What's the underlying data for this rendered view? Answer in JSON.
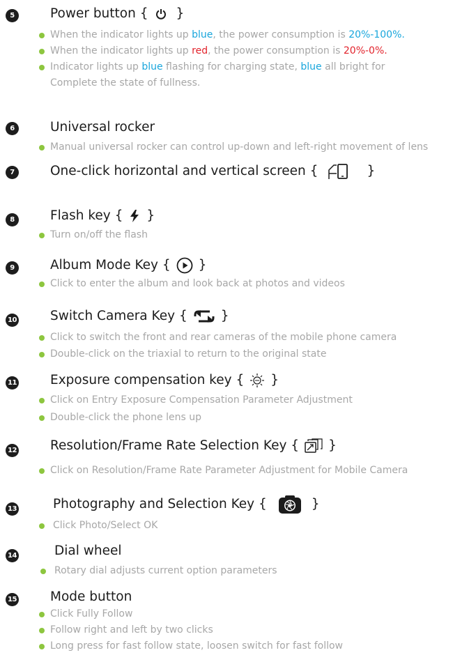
{
  "colors": {
    "bullet": "#8dc63f",
    "blue": "#19a6dc",
    "red": "#e2232c",
    "text": "#a7a7a7",
    "title": "#1c1c1c"
  },
  "sections": [
    {
      "number": "5",
      "title": "Power button",
      "icon": "power-icon",
      "brace_open": "{",
      "brace_close": "}",
      "bullets": [
        {
          "parts": [
            "When the indicator lights up ",
            "blue",
            ", the power consumption is ",
            "20%-100%."
          ]
        },
        {
          "parts": [
            "When the indicator lights up ",
            "red",
            ", the power consumption is ",
            "20%-0%."
          ]
        },
        {
          "parts": [
            "Indicator lights up ",
            "blue",
            " flashing for charging state, ",
            "blue",
            " all bright for"
          ]
        },
        {
          "text": "Complete the state of fullness."
        }
      ]
    },
    {
      "number": "6",
      "title": "Universal rocker",
      "bullets": [
        {
          "text": "Manual universal rocker can control up-down and left-right movement of lens"
        }
      ]
    },
    {
      "number": "7",
      "title": "One-click horizontal and vertical screen",
      "icon": "screen-rotate-icon",
      "brace_open": "{",
      "brace_close": "}",
      "bullets": []
    },
    {
      "number": "8",
      "title": "Flash key",
      "icon": "flash-icon",
      "brace_open": "{",
      "brace_close": "}",
      "bullets": [
        {
          "text": "Turn on/off the flash"
        }
      ]
    },
    {
      "number": "9",
      "title": "Album Mode Key",
      "icon": "play-circle-icon",
      "brace_open": "{",
      "brace_close": "}",
      "bullets": [
        {
          "text": "Click to enter the album and look back at photos and videos"
        }
      ]
    },
    {
      "number": "10",
      "title": "Switch Camera Key",
      "icon": "switch-arrows-icon",
      "brace_open": "{",
      "brace_close": "}",
      "bullets": [
        {
          "text": "Click to switch the front and rear cameras of the mobile phone camera"
        },
        {
          "text": "Double-click on the triaxial to return to the original state"
        }
      ]
    },
    {
      "number": "11",
      "title": "Exposure compensation key",
      "icon": "exposure-icon",
      "brace_open": "{",
      "brace_close": "}",
      "bullets": [
        {
          "text": "Click on Entry Exposure Compensation Parameter Adjustment"
        },
        {
          "text": "Double-click the phone lens up"
        }
      ]
    },
    {
      "number": "12",
      "title": "Resolution/Frame Rate Selection Key",
      "icon": "resolution-icon",
      "brace_open": "{",
      "brace_close": "}",
      "bullets": [
        {
          "text": "Click on Resolution/Frame Rate Parameter Adjustment for Mobile Camera"
        }
      ]
    },
    {
      "number": "13",
      "title": "Photography and Selection Key",
      "icon": "camera-aperture-icon",
      "brace_open": "{",
      "brace_close": "}",
      "bullets": [
        {
          "text": "Click Photo/Select OK"
        }
      ]
    },
    {
      "number": "14",
      "title": "Dial wheel",
      "bullets": [
        {
          "text": "Rotary dial adjusts current option parameters"
        }
      ]
    },
    {
      "number": "15",
      "title": "Mode button",
      "bullets": [
        {
          "text": "Click Fully Follow"
        },
        {
          "text": "Follow right and left by two clicks"
        },
        {
          "text": "Long press for fast follow state, loosen switch for fast follow"
        }
      ]
    }
  ]
}
